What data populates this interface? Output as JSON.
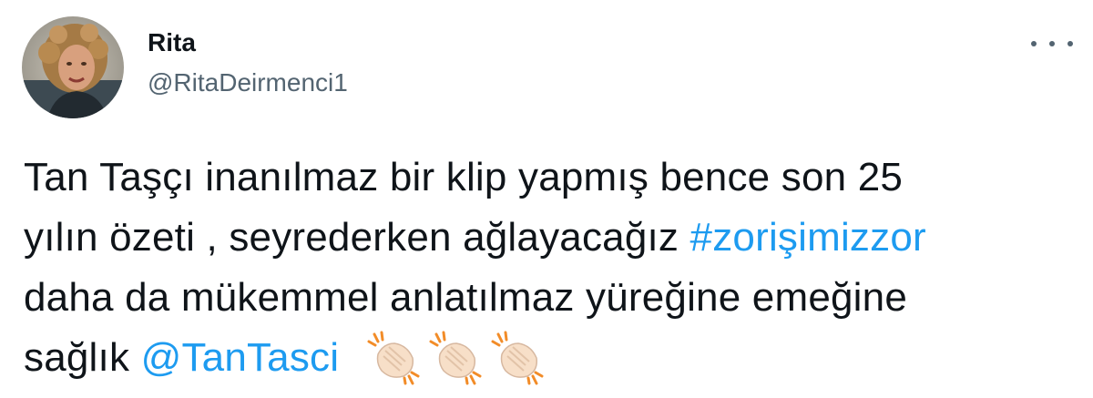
{
  "tweet": {
    "author": {
      "display_name": "Rita",
      "handle": "@RitaDeirmenci1"
    },
    "body": {
      "line1": "Tan Taşçı inanılmaz bir klip yapmış bence son 25",
      "line2_text": "yılın özeti , seyrederken ağlayacağız ",
      "hashtag": "#zorişimizzor",
      "line3": "daha da mükemmel anlatılmaz yüreğine emeğine",
      "line4_text": "sağlık ",
      "mention": "@TanTasci",
      "emojis": [
        "clapping-hands",
        "clapping-hands",
        "clapping-hands"
      ]
    },
    "colors": {
      "link": "#1d9bf0",
      "text": "#0f1419",
      "secondary": "#536471"
    }
  }
}
